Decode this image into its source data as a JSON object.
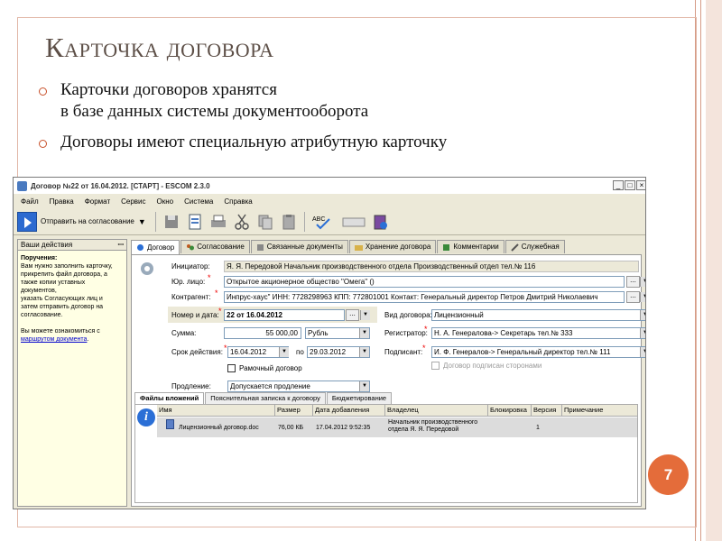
{
  "slide": {
    "title": "Карточка договора",
    "bullets": [
      "Карточки договоров хранятся\nв базе данных системы документооборота",
      "Договоры имеют специальную атрибутную карточку"
    ],
    "page_number": "7"
  },
  "window": {
    "title": "Договор №22 от 16.04.2012. [СТАРТ] - ESCOM 2.3.0",
    "controls": [
      "_",
      "□",
      "×"
    ],
    "menu": [
      "Файл",
      "Правка",
      "Формат",
      "Сервис",
      "Окно",
      "Система",
      "Справка"
    ],
    "toolbar": {
      "send_label": "Отправить на согласование",
      "icons": [
        "save-icon",
        "document-icon",
        "print-icon",
        "cut-icon",
        "copy-icon",
        "paste-icon",
        "spellcheck-icon",
        "field-icon",
        "archive-icon"
      ]
    },
    "side_panel": {
      "header": "Ваши действия",
      "pin": "ꟷ",
      "heading": "Поручения:",
      "text": "Вам нужно заполнить карточку,\nприкрепить файл договора, а\nтакже копии уставных\nдокументов,\nуказать Согласующих лиц и\nзатем отправить договор на\nсогласование.\n\nВы можете ознакомиться с",
      "link": "маршрутом документа",
      "link_tail": "."
    },
    "tabs": [
      "Договор",
      "Согласование",
      "Связанные документы",
      "Хранение договора",
      "Комментарии",
      "Служебная"
    ],
    "form": {
      "initiator_label": "Инициатор:",
      "initiator_value": "Я. Я. Передовой Начальник производственного отдела Производственный отдел тел.№ 116",
      "legal_label": "Юр. лицо:",
      "legal_value": "Открытое акционерное общество \"Омега\" ()",
      "counterparty_label": "Контрагент:",
      "counterparty_value": "Инпрус-хаус\" ИНН: 7728298963 КПП: 772801001 Контакт: Генеральный директор Петров Дмитрий Николаевич",
      "number_label": "Номер и дата:",
      "number_value": "22 от 16.04.2012",
      "type_label": "Вид договора:",
      "type_value": "Лицензионный",
      "sum_label": "Сумма:",
      "sum_value": "55 000,00",
      "currency_value": "Рубль",
      "registrar_label": "Регистратор:",
      "registrar_value": "Н. А. Генералова-> Секретарь тел.№ 333",
      "term_label": "Срок действия:",
      "term_from": "16.04.2012",
      "term_by": "по",
      "term_to": "29.03.2012",
      "signer_label": "Подписант:",
      "signer_value": "И. Ф. Генералов-> Генеральный директор тел.№ 111",
      "frame_contract_label": "Рамочный договор",
      "signed_label": "Договор подписан сторонами",
      "extension_label": "Продление:",
      "extension_value": "Допускается продление",
      "ellipsis": "...",
      "dropdown_glyph": "▼"
    },
    "subtabs": [
      "Файлы вложений",
      "Пояснительная записка к договору",
      "Бюджетирование"
    ],
    "files_table": {
      "info_glyph": "i",
      "columns": [
        "Имя",
        "Размер",
        "Дата добавления",
        "Владелец",
        "Блокировка",
        "Версия",
        "Примечание"
      ],
      "rows": [
        {
          "name": "Лицензионный договор.doc",
          "size": "76,00 КБ",
          "date": "17.04.2012 9:52:35",
          "owner": "Начальник производственного\nотдела Я. Я. Передовой",
          "lock": "",
          "version": "1",
          "note": ""
        }
      ]
    }
  },
  "colors": {
    "accent": "#e46c3a",
    "title": "#5d4f47",
    "bullet": "#c8502a",
    "panel_bg": "#ffffe4"
  }
}
